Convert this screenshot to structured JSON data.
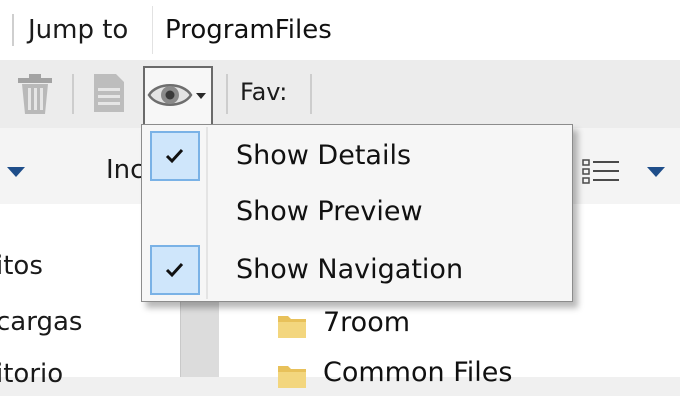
{
  "jump_bar": {
    "label": "Jump to",
    "value": "ProgramFiles"
  },
  "toolbar": {
    "fav_label": "Fav:",
    "icons": [
      "trash-icon",
      "document-icon",
      "eye-icon",
      "dropdown-arrow-icon"
    ]
  },
  "header": {
    "column_label_partial": "Inc"
  },
  "nav_pane": {
    "items": [
      "itos",
      "cargas",
      "itorio"
    ]
  },
  "file_list": {
    "items": [
      "7room",
      "Common Files"
    ]
  },
  "view_menu": {
    "items": [
      {
        "label": "Show Details",
        "checked": true
      },
      {
        "label": "Show Preview",
        "checked": false
      },
      {
        "label": "Show Navigation",
        "checked": true
      }
    ]
  },
  "colors": {
    "check_bg": "#cfe6fb",
    "check_border": "#7ab2e6",
    "folder": "#e8c15a"
  }
}
